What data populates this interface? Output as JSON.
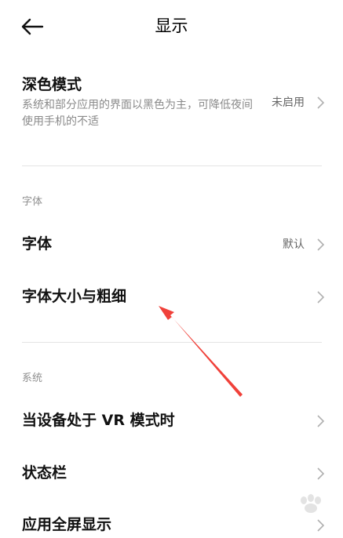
{
  "header": {
    "title": "显示"
  },
  "dark_mode": {
    "title": "深色模式",
    "description": "系统和部分应用的界面以黑色为主，可降低夜间使用手机的不适",
    "value": "未启用"
  },
  "font_section": {
    "label": "字体",
    "items": [
      {
        "title": "字体",
        "value": "默认"
      },
      {
        "title": "字体大小与粗细",
        "value": ""
      }
    ]
  },
  "system_section": {
    "label": "系统",
    "items": [
      {
        "title": "当设备处于 VR 模式时"
      },
      {
        "title": "状态栏"
      },
      {
        "title": "应用全屏显示"
      }
    ]
  },
  "annotation": {
    "color": "#f0413a"
  },
  "colors": {
    "title_text": "#111111",
    "secondary_text": "#8a8a8a",
    "divider": "#e4e4e4"
  }
}
